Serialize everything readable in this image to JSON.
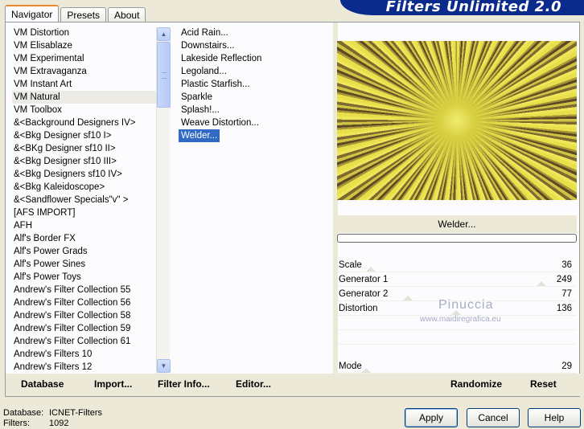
{
  "window": {
    "banner_title": "Filters Unlimited 2.0"
  },
  "tabs": [
    {
      "label": "Navigator",
      "active": true
    },
    {
      "label": "Presets",
      "active": false
    },
    {
      "label": "About",
      "active": false
    }
  ],
  "categories": [
    "VM Distortion",
    "VM Elisablaze",
    "VM Experimental",
    "VM Extravaganza",
    "VM Instant Art",
    "VM Natural",
    "VM Toolbox",
    "&<Background Designers IV>",
    "&<Bkg Designer sf10 I>",
    "&<BKg Designer sf10 II>",
    "&<Bkg Designer sf10 III>",
    "&<Bkg Designers sf10 IV>",
    "&<Bkg Kaleidoscope>",
    "&<Sandflower Specials\"v\" >",
    "[AFS IMPORT]",
    "AFH",
    "Alf's Border FX",
    "Alf's Power Grads",
    "Alf's Power Sines",
    "Alf's Power Toys",
    "Andrew's Filter Collection 55",
    "Andrew's Filter Collection 56",
    "Andrew's Filter Collection 58",
    "Andrew's Filter Collection 59",
    "Andrew's Filter Collection 61",
    "Andrew's Filters 10",
    "Andrew's Filters 12"
  ],
  "selected_category": "VM Natural",
  "filters": [
    "Acid Rain...",
    "Downstairs...",
    "Lakeside Reflection",
    "Legoland...",
    "Plastic Starfish...",
    "Sparkle",
    "Splash!...",
    "Weave Distortion...",
    "Welder..."
  ],
  "selected_filter": "Welder...",
  "toolbar": {
    "database": "Database",
    "import": "Import...",
    "filter_info": "Filter Info...",
    "editor": "Editor..."
  },
  "preview": {
    "filter_name": "Welder..."
  },
  "params": [
    {
      "label": "Scale",
      "value": "36"
    },
    {
      "label": "Generator 1",
      "value": "249"
    },
    {
      "label": "Generator 2",
      "value": "77"
    },
    {
      "label": "Distortion",
      "value": "136"
    }
  ],
  "mode": {
    "label": "Mode",
    "value": "29"
  },
  "right_toolbar": {
    "randomize": "Randomize",
    "reset": "Reset"
  },
  "watermark": {
    "name": "Pinuccia",
    "url": "www.maidiregrafica.eu"
  },
  "status": {
    "database_label": "Database:",
    "database_value": "ICNET-Filters",
    "filters_label": "Filters:",
    "filters_value": "1092"
  },
  "buttons": {
    "apply": "Apply",
    "cancel": "Cancel",
    "help": "Help"
  }
}
